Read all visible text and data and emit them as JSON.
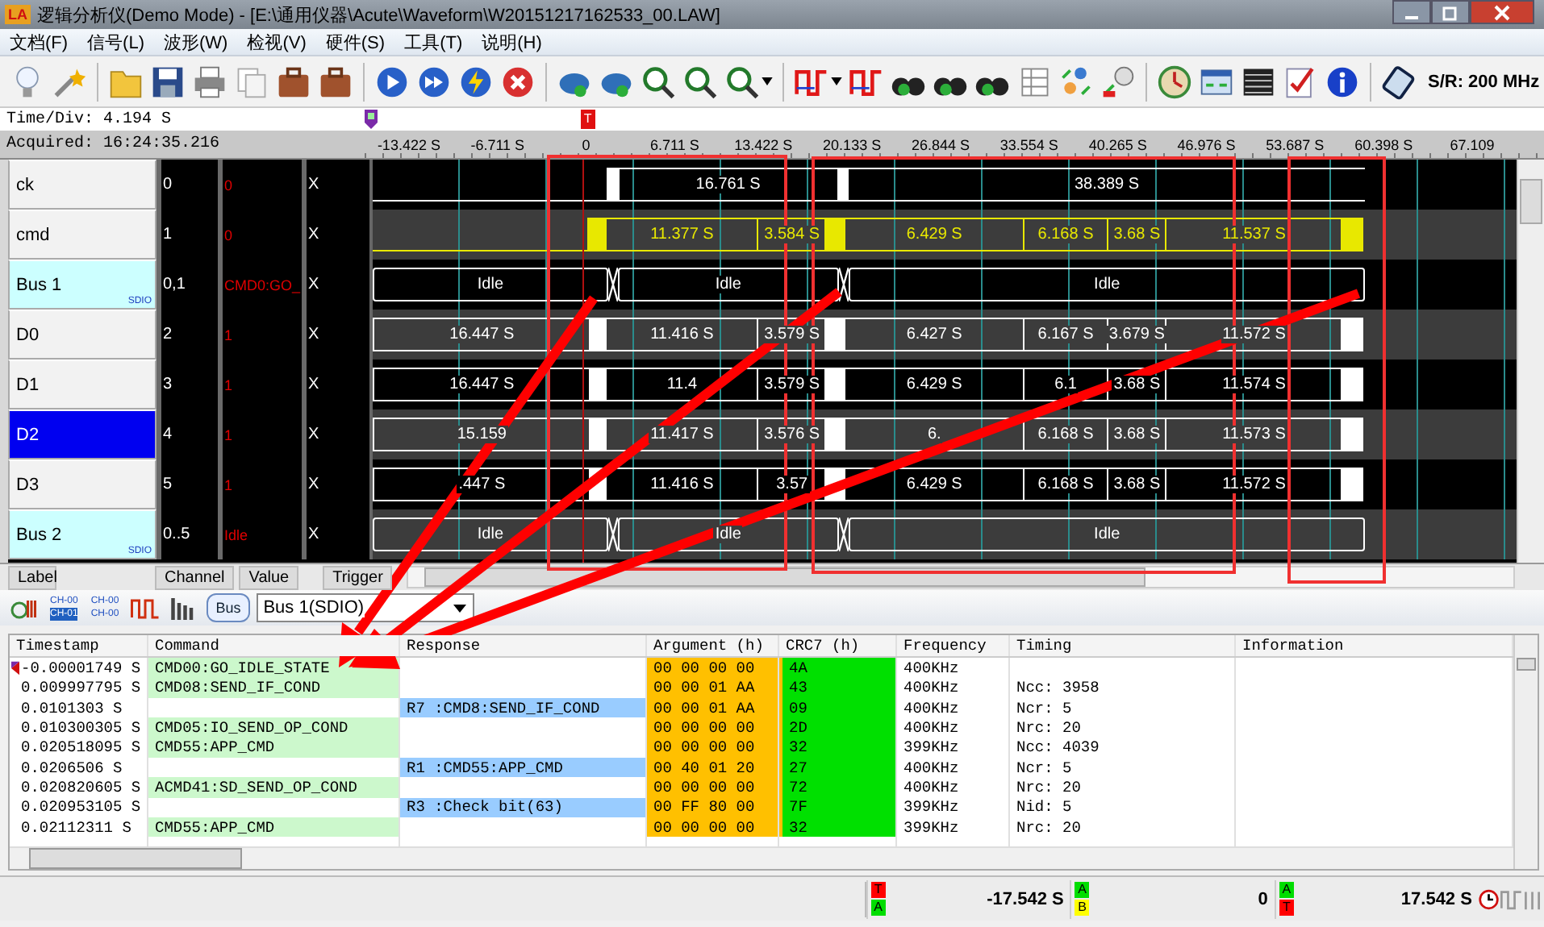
{
  "window": {
    "logo": "LA",
    "title": "逻辑分析仪(Demo Mode) - [E:\\通用仪器\\Acute\\Waveform\\W20151217162533_00.LAW]"
  },
  "menu": [
    "文档(F)",
    "信号(L)",
    "波形(W)",
    "检视(V)",
    "硬件(S)",
    "工具(T)",
    "说明(H)"
  ],
  "toolbar": {
    "sample_rate": "S/R: 200 MHz"
  },
  "timebase": {
    "time_div": "Time/Div: 4.194 S",
    "acquired": "Acquired: 16:24:35.216",
    "trigger_marker": "T",
    "axis_labels": [
      "-13.422 S",
      "-6.711 S",
      "0",
      "6.711 S",
      "13.422 S",
      "20.133 S",
      "26.844 S",
      "33.554 S",
      "40.265 S",
      "46.976 S",
      "53.687 S",
      "60.398 S",
      "67.109"
    ]
  },
  "channels": [
    {
      "label": "ck",
      "kind": "clock",
      "selected": false,
      "channel": "0",
      "value": "0",
      "trigger": "X",
      "color": "#ffffff",
      "segments": [
        "16.761 S",
        "38.389 S"
      ]
    },
    {
      "label": "cmd",
      "kind": "command",
      "selected": false,
      "channel": "1",
      "value": "0",
      "trigger": "X",
      "color": "#e8e800",
      "segments": [
        "11.377 S",
        "3.584 S",
        "6.429 S",
        "6.168 S",
        "3.68 S",
        "11.537 S"
      ]
    },
    {
      "label": "Bus 1",
      "kind": "bus",
      "protocol": "SDIO",
      "selected": false,
      "channel": "0,1",
      "value": "CMD0:GO_",
      "trigger": "X",
      "color": "#ffffff",
      "segments": [
        "Idle",
        "Idle",
        "Idle"
      ]
    },
    {
      "label": "D0",
      "kind": "data",
      "selected": false,
      "channel": "2",
      "value": "1",
      "trigger": "X",
      "color": "#ffffff",
      "segments": [
        "16.447 S",
        "11.416 S",
        "3.579 S",
        "6.427 S",
        "6.167 S",
        "3.679 S",
        "11.572 S"
      ]
    },
    {
      "label": "D1",
      "kind": "data",
      "selected": false,
      "channel": "3",
      "value": "1",
      "trigger": "X",
      "color": "#ffffff",
      "segments": [
        "16.447 S",
        "11.4",
        "3.579 S",
        "6.429 S",
        "6.1",
        "3.68 S",
        "11.574 S"
      ]
    },
    {
      "label": "D2",
      "kind": "data",
      "selected": true,
      "channel": "4",
      "value": "1",
      "trigger": "X",
      "color": "#ffffff",
      "segments": [
        "15.159",
        "11.417 S",
        "3.576 S",
        "6.",
        "6.168 S",
        "3.68 S",
        "11.573 S"
      ]
    },
    {
      "label": "D3",
      "kind": "data",
      "selected": false,
      "channel": "5",
      "value": "1",
      "trigger": "X",
      "color": "#ffffff",
      "segments": [
        ".447 S",
        "11.416 S",
        "3.57",
        "6.429 S",
        "6.168 S",
        "3.68 S",
        "11.572 S"
      ]
    },
    {
      "label": "Bus 2",
      "kind": "bus",
      "protocol": "SDIO",
      "selected": false,
      "channel": "0..5",
      "value": "Idle",
      "trigger": "X",
      "color": "#ffffff",
      "segments": [
        "Idle",
        "Idle",
        "Idle"
      ]
    }
  ],
  "panel_tabs": [
    "Label",
    "Channel",
    "Value",
    "Trigger"
  ],
  "decoder_bar": {
    "channel_icons": [
      [
        "CH-00",
        "CH-01"
      ],
      [
        "CH-00",
        "CH-00"
      ]
    ],
    "bus_icon": "Bus",
    "bus_select": "Bus 1(SDIO)"
  },
  "table": {
    "columns": [
      "Timestamp",
      "Command",
      "Response",
      "Argument (h)",
      "CRC7 (h)",
      "Frequency",
      "Timing",
      "Information"
    ],
    "rows": [
      {
        "kind": "command",
        "marker": true,
        "timestamp": "-0.00001749 S",
        "command": "CMD00:GO_IDLE_STATE",
        "argument": "00 00 00 00",
        "crc7": "4A",
        "frequency": "400KHz"
      },
      {
        "kind": "command",
        "marker": false,
        "timestamp": "0.009997795 S",
        "command": "CMD08:SEND_IF_COND",
        "argument": "00 00 01 AA",
        "crc7": "43",
        "frequency": "400KHz",
        "timing": "Ncc: 3958"
      },
      {
        "kind": "response",
        "marker": false,
        "timestamp": "0.0101303 S",
        "response": "R7 :CMD8:SEND_IF_COND",
        "argument": "00 00 01 AA",
        "crc7": "09",
        "frequency": "400KHz",
        "timing": "Ncr: 5"
      },
      {
        "kind": "command",
        "marker": false,
        "timestamp": "0.010300305 S",
        "command": "CMD05:IO_SEND_OP_COND",
        "argument": "00 00 00 00",
        "crc7": "2D",
        "frequency": "400KHz",
        "timing": "Nrc: 20"
      },
      {
        "kind": "command",
        "marker": false,
        "timestamp": "0.020518095 S",
        "command": "CMD55:APP_CMD",
        "argument": "00 00 00 00",
        "crc7": "32",
        "frequency": "399KHz",
        "timing": "Ncc: 4039"
      },
      {
        "kind": "response",
        "marker": false,
        "timestamp": "0.0206506 S",
        "response": "R1 :CMD55:APP_CMD",
        "argument": "00 40 01 20",
        "crc7": "27",
        "frequency": "400KHz",
        "timing": "Ncr: 5"
      },
      {
        "kind": "command",
        "marker": false,
        "timestamp": "0.020820605 S",
        "command": "ACMD41:SD_SEND_OP_COND",
        "argument": "00 00 00 00",
        "crc7": "72",
        "frequency": "400KHz",
        "timing": "Nrc: 20"
      },
      {
        "kind": "response",
        "marker": false,
        "timestamp": "0.020953105 S",
        "response": "R3 :Check bit(63)",
        "argument": "00 FF 80 00",
        "crc7": "7F",
        "frequency": "399KHz",
        "timing": "Nid: 5"
      },
      {
        "kind": "command",
        "marker": false,
        "timestamp": "0.02112311 S",
        "command": "CMD55:APP_CMD",
        "argument": "00 00 00 00",
        "crc7": "32",
        "frequency": "399KHz",
        "timing": "Nrc: 20"
      }
    ]
  },
  "status_bar": {
    "measurements": [
      {
        "badges": [
          {
            "text": "T",
            "color": "#ff0000"
          },
          {
            "text": "A",
            "color": "#00dd00"
          }
        ],
        "value": "-17.542 S"
      },
      {
        "badges": [
          {
            "text": "A",
            "color": "#00dd00"
          },
          {
            "text": "B",
            "color": "#ffff00"
          }
        ],
        "value": "0"
      },
      {
        "badges": [
          {
            "text": "A",
            "color": "#00dd00"
          },
          {
            "text": "T",
            "color": "#ff0000"
          }
        ],
        "value": "17.542 S"
      }
    ]
  }
}
